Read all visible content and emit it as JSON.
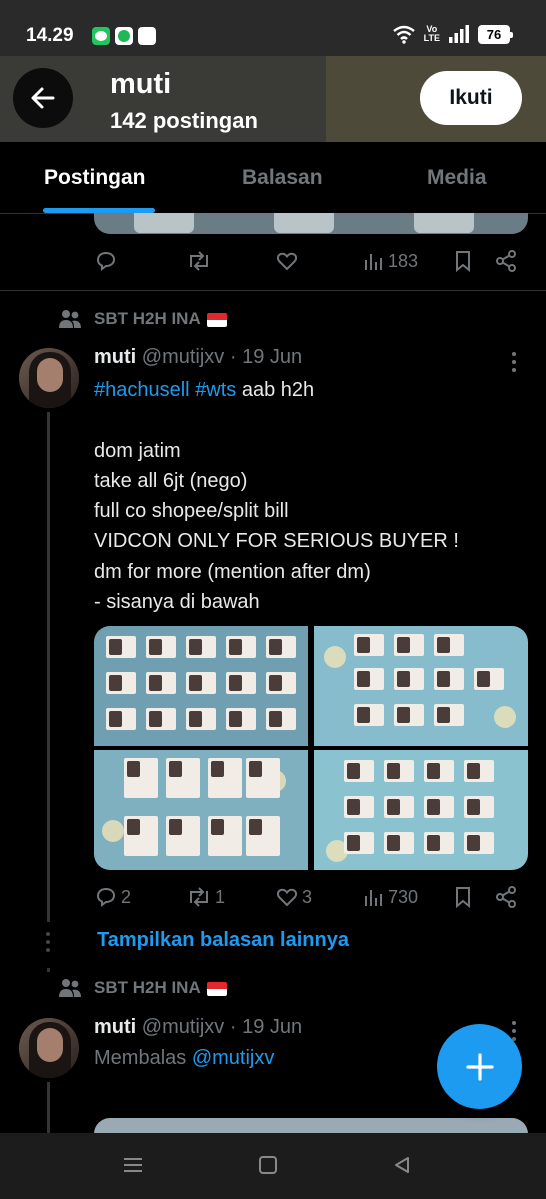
{
  "status_bar": {
    "time": "14.29",
    "volte_top": "Vo",
    "volte_bottom": "LTE",
    "battery": "76"
  },
  "profile_header": {
    "name": "muti",
    "post_count": "142 postingan",
    "follow_label": "Ikuti"
  },
  "tabs": [
    {
      "label": "Postingan",
      "active": true
    },
    {
      "label": "Balasan",
      "active": false
    },
    {
      "label": "Media",
      "active": false
    }
  ],
  "prev_post": {
    "views": "183"
  },
  "posts": [
    {
      "repost_by": "SBT H2H INA",
      "author_name": "muti",
      "handle_date": "@mutijxv · 19 Jun",
      "hashtag1": "#hachusell",
      "hashtag2": "#wts",
      "first_line_rest": " aab h2h",
      "lines": [
        "dom jatim",
        "take all 6jt (nego)",
        "full co shopee/split bill",
        "VIDCON ONLY FOR SERIOUS BUYER !",
        "dm for more (mention after dm)",
        "- sisanya di bawah"
      ],
      "replies": "2",
      "reposts": "1",
      "likes": "3",
      "views": "730"
    },
    {
      "repost_by": "SBT H2H INA",
      "author_name": "muti",
      "handle_date": "@mutijxv · 19 Jun",
      "reply_prefix": "Membalas ",
      "reply_to": "@mutijxv"
    }
  ],
  "show_more_replies": "Tampilkan balasan lainnya",
  "icons": {
    "back": "back-arrow-icon",
    "reply": "reply-icon",
    "repost": "repost-icon",
    "like": "like-icon",
    "views": "views-icon",
    "bookmark": "bookmark-icon",
    "share": "share-icon",
    "compose": "compose-plus-icon"
  },
  "colors": {
    "accent": "#1d9bf0",
    "background": "#000000",
    "muted": "#71767b"
  }
}
